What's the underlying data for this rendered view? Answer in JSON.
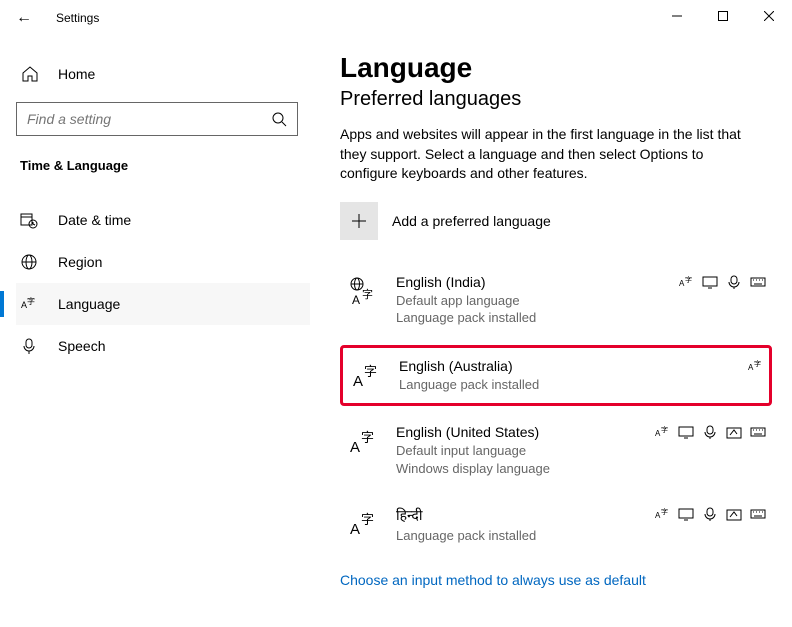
{
  "window": {
    "title": "Settings"
  },
  "sidebar": {
    "home_label": "Home",
    "search_placeholder": "Find a setting",
    "category": "Time & Language",
    "items": [
      {
        "label": "Date & time"
      },
      {
        "label": "Region"
      },
      {
        "label": "Language"
      },
      {
        "label": "Speech"
      }
    ]
  },
  "main": {
    "page_title": "Language",
    "section_title": "Preferred languages",
    "description": "Apps and websites will appear in the first language in the list that they support. Select a language and then select Options to configure keyboards and other features.",
    "add_label": "Add a preferred language",
    "languages": [
      {
        "name": "English (India)",
        "sub1": "Default app language",
        "sub2": "Language pack installed"
      },
      {
        "name": "English (Australia)",
        "sub1": "Language pack installed"
      },
      {
        "name": "English (United States)",
        "sub1": "Default input language",
        "sub2": "Windows display language"
      },
      {
        "name": "हिन्दी",
        "sub1": "Language pack installed"
      }
    ],
    "link": "Choose an input method to always use as default"
  }
}
